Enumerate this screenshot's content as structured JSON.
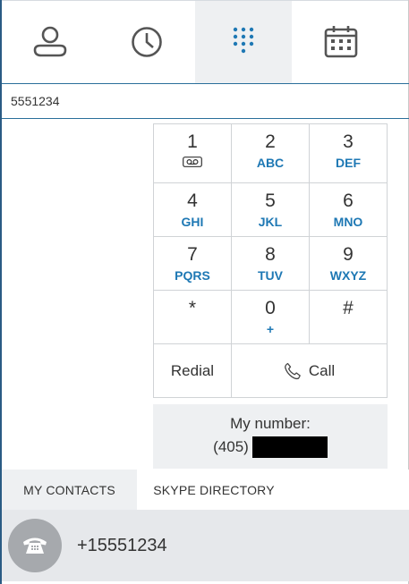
{
  "top_tabs": [
    {
      "id": "contacts",
      "icon": "person-icon",
      "active": false
    },
    {
      "id": "recent",
      "icon": "clock-icon",
      "active": false
    },
    {
      "id": "dialpad",
      "icon": "dialpad-icon",
      "active": true
    },
    {
      "id": "calendar",
      "icon": "calendar-icon",
      "active": false
    }
  ],
  "number_input": {
    "value": "5551234"
  },
  "dialpad": {
    "keys": [
      {
        "digit": "1",
        "letters": "",
        "icon": "voicemail-icon"
      },
      {
        "digit": "2",
        "letters": "ABC"
      },
      {
        "digit": "3",
        "letters": "DEF"
      },
      {
        "digit": "4",
        "letters": "GHI"
      },
      {
        "digit": "5",
        "letters": "JKL"
      },
      {
        "digit": "6",
        "letters": "MNO"
      },
      {
        "digit": "7",
        "letters": "PQRS"
      },
      {
        "digit": "8",
        "letters": "TUV"
      },
      {
        "digit": "9",
        "letters": "WXYZ"
      },
      {
        "digit": "*",
        "letters": ""
      },
      {
        "digit": "0",
        "letters": "+"
      },
      {
        "digit": "#",
        "letters": ""
      }
    ],
    "redial_label": "Redial",
    "call_label": "Call"
  },
  "my_number": {
    "label": "My number:",
    "prefix": "(405)"
  },
  "bottom_tabs": [
    {
      "label": "MY CONTACTS",
      "active": true
    },
    {
      "label": "SKYPE DIRECTORY",
      "active": false
    }
  ],
  "contact": {
    "name": "+15551234",
    "icon": "phone-icon"
  },
  "colors": {
    "accent": "#1e78b4",
    "border": "#2a5b84",
    "active_bg": "#eef0f2"
  }
}
